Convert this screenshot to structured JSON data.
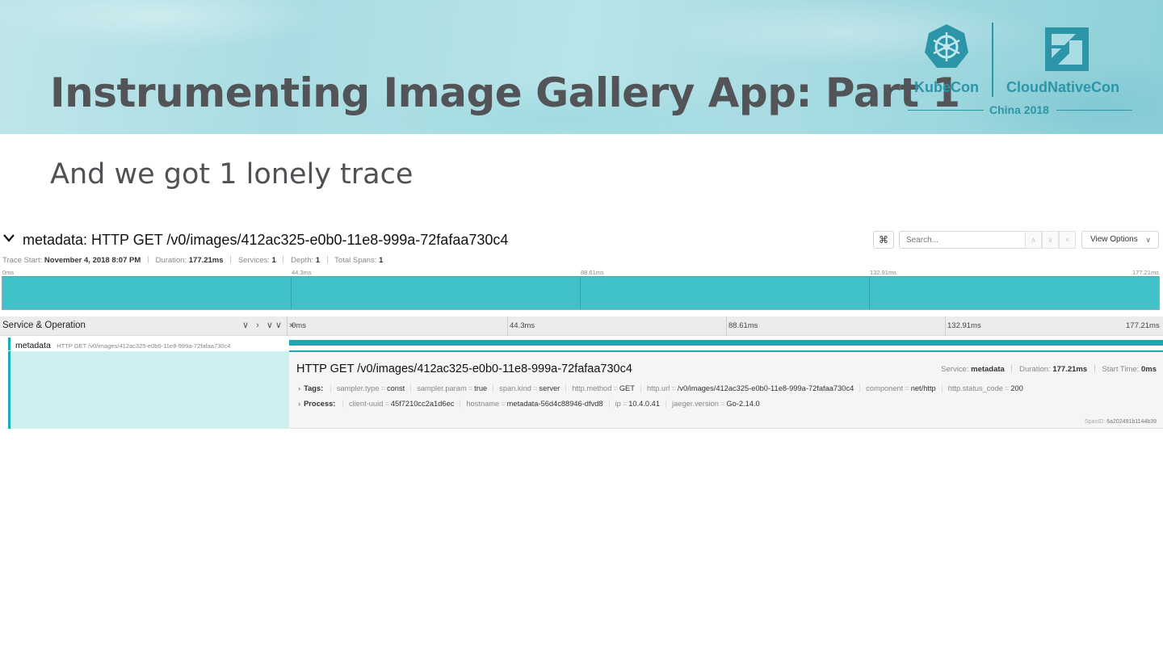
{
  "slide": {
    "title": "Instrumenting Image Gallery App: Part 1",
    "subtitle": "And we got 1 lonely trace",
    "logos": {
      "kubecon": "KubeCon",
      "cloudnativecon": "CloudNativeCon",
      "event": "China 2018",
      "accent_color": "#2d95a8"
    }
  },
  "trace": {
    "title": "metadata: HTTP GET /v0/images/412ac325-e0b0-11e8-999a-72fafaa730c4",
    "collapse_icon": "chevron-down-icon",
    "toolbar": {
      "shortcut_glyph": "⌘",
      "search_placeholder": "Search...",
      "prev_glyph": "∧",
      "next_glyph": "∨",
      "clear_glyph": "×",
      "view_options_label": "View Options",
      "view_options_caret": "∨"
    },
    "meta": {
      "start_label": "Trace Start:",
      "start_value": "November 4, 2018 8:07 PM",
      "duration_label": "Duration:",
      "duration_value": "177.21ms",
      "services_label": "Services:",
      "services_value": "1",
      "depth_label": "Depth:",
      "depth_value": "1",
      "spans_label": "Total Spans:",
      "spans_value": "1"
    },
    "ticks": [
      "0ms",
      "44.3ms",
      "88.61ms",
      "132.91ms",
      "177.21ms"
    ],
    "minimap_color": "#41c2c8",
    "span_header": {
      "label": "Service & Operation",
      "controls": "∨ › ∨∨ »"
    },
    "span": {
      "service": "metadata",
      "operation": "HTTP GET /v0/images/412ac325-e0b0-11e8-999a-72fafaa730c4",
      "bar_color": "#1ea7b0",
      "start_fraction": 0,
      "duration_fraction": 1
    },
    "detail": {
      "operation": "HTTP GET /v0/images/412ac325-e0b0-11e8-999a-72fafaa730c4",
      "service_label": "Service:",
      "service_value": "metadata",
      "duration_label": "Duration:",
      "duration_value": "177.21ms",
      "start_label": "Start Time:",
      "start_value": "0ms",
      "tags_label": "Tags:",
      "tags": [
        {
          "key": "sampler.type",
          "value": "const"
        },
        {
          "key": "sampler.param",
          "value": "true"
        },
        {
          "key": "span.kind",
          "value": "server"
        },
        {
          "key": "http.method",
          "value": "GET"
        },
        {
          "key": "http.url",
          "value": "/v0/images/412ac325-e0b0-11e8-999a-72fafaa730c4"
        },
        {
          "key": "component",
          "value": "net/http"
        },
        {
          "key": "http.status_code",
          "value": "200"
        }
      ],
      "process_label": "Process:",
      "process": [
        {
          "key": "client-uuid",
          "value": "45f7210cc2a1d6ec"
        },
        {
          "key": "hostname",
          "value": "metadata-56d4c88946-dfvd8"
        },
        {
          "key": "ip",
          "value": "10.4.0.41"
        },
        {
          "key": "jaeger.version",
          "value": "Go-2.14.0"
        }
      ],
      "span_id_label": "SpanID:",
      "span_id_value": "6a202491b1144b39"
    }
  }
}
